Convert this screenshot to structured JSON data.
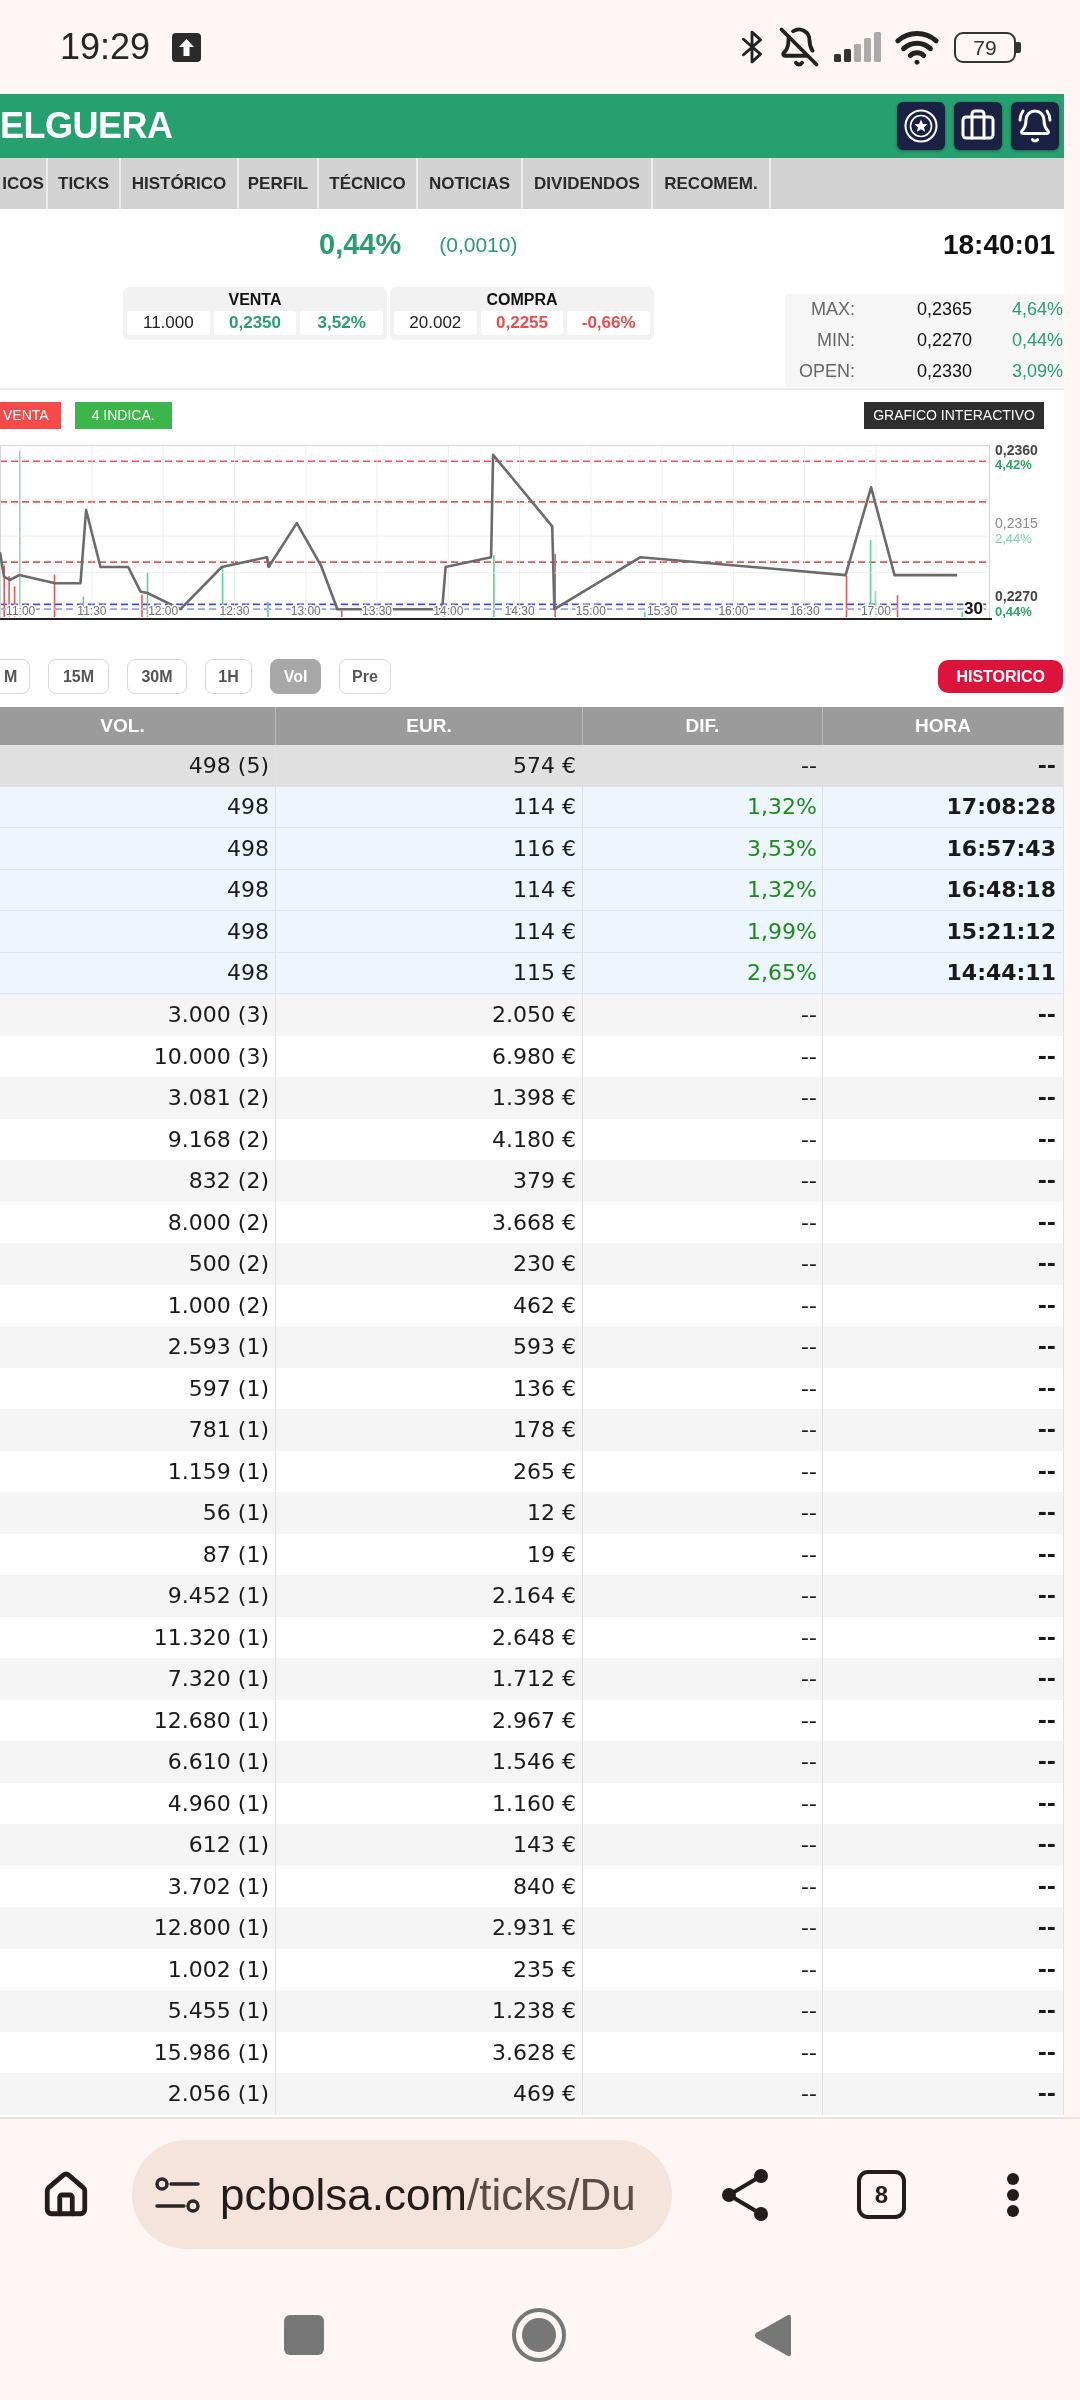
{
  "status_bar": {
    "time": "19:29",
    "battery": "79"
  },
  "header": {
    "title": "ELGUERA"
  },
  "tabs": [
    {
      "label": "ICOS"
    },
    {
      "label": "TICKS"
    },
    {
      "label": "HISTÓRICO"
    },
    {
      "label": "PERFIL"
    },
    {
      "label": "TÉCNICO"
    },
    {
      "label": "NOTICIAS"
    },
    {
      "label": "DIVIDENDOS"
    },
    {
      "label": "RECOMEM."
    }
  ],
  "quote": {
    "change_pct": "0,44%",
    "change_abs": "(0,0010)",
    "time": "18:40:01"
  },
  "order_book": [
    {
      "title": "VENTA",
      "quantity": "11.000",
      "price": "0,2350",
      "change": "3,52%",
      "color": "#2a9d6f"
    },
    {
      "title": "COMPRA",
      "quantity": "20.002",
      "price": "0,2255",
      "change": "-0,66%",
      "color": "#ef4b4b"
    }
  ],
  "range_stats": [
    {
      "label": "MAX:",
      "value": "0,2365",
      "change": "4,64%"
    },
    {
      "label": "MIN:",
      "value": "0,2270",
      "change": "0,44%"
    },
    {
      "label": "OPEN:",
      "value": "0,2330",
      "change": "3,09%"
    }
  ],
  "signals": [
    {
      "label": "VENTA",
      "color": "#f44a4a"
    },
    {
      "label": "4 INDICA.",
      "color": "#3cb54a"
    }
  ],
  "interactive_chart_button": "GRAFICO INTERACTIVO",
  "chart": {
    "period_label": "30",
    "chart_data": {
      "type": "line",
      "x": [
        10.855,
        10.884,
        10.923,
        10.99,
        11.242,
        11.42,
        11.459,
        11.56,
        11.754,
        11.84,
        11.889,
        12.121,
        12.411,
        12.729,
        12.739,
        12.937,
        13.106,
        13.222,
        13.957,
        13.981,
        14.3,
        14.314,
        14.729,
        14.744,
        15.348,
        16.787,
        16.966,
        17.13,
        17.57
      ],
      "values": [
        0.2305,
        0.229,
        0.2288,
        0.2291,
        0.2286,
        0.2286,
        0.2331,
        0.2296,
        0.2296,
        0.2281,
        0.228,
        0.227,
        0.2296,
        0.2302,
        0.2296,
        0.2323,
        0.2297,
        0.227,
        0.227,
        0.2296,
        0.2302,
        0.2365,
        0.2321,
        0.227,
        0.2302,
        0.2291,
        0.2345,
        0.2291,
        0.2291
      ],
      "xlim": [
        10.855,
        17.8
      ],
      "ylim": [
        0.2264,
        0.2371
      ],
      "grid": true,
      "xticks": [
        {
          "value": 11,
          "label": "11:00"
        },
        {
          "value": 11.5,
          "label": "11:30"
        },
        {
          "value": 12,
          "label": "12:00"
        },
        {
          "value": 12.5,
          "label": "12:30"
        },
        {
          "value": 13,
          "label": "13:00"
        },
        {
          "value": 13.5,
          "label": "13:30"
        },
        {
          "value": 14,
          "label": "14:00"
        },
        {
          "value": 14.5,
          "label": "14:30"
        },
        {
          "value": 15,
          "label": "15:00"
        },
        {
          "value": 15.5,
          "label": "15:30"
        },
        {
          "value": 16,
          "label": "16:00"
        },
        {
          "value": 16.5,
          "label": "16:30"
        },
        {
          "value": 17,
          "label": "17:00"
        }
      ],
      "yticks": [
        {
          "value": 0.227,
          "label": "0,2270"
        },
        {
          "value": 0.2315,
          "label": "0,2315"
        },
        {
          "value": 0.236,
          "label": "0,2360"
        }
      ],
      "annotations": [
        "0,44%",
        "2,44%",
        "4,42%"
      ]
    }
  },
  "timeframes": [
    {
      "label": "M",
      "selected": false
    },
    {
      "label": "15M",
      "selected": false
    },
    {
      "label": "30M",
      "selected": false
    },
    {
      "label": "1H",
      "selected": false
    },
    {
      "label": "Vol",
      "selected": true
    },
    {
      "label": "Pre",
      "selected": false
    }
  ],
  "history_button": "HISTORICO",
  "table": {
    "columns": [
      "VOL.",
      "EUR.",
      "DIF.",
      "HORA"
    ],
    "rows": [
      {
        "kind": "total",
        "cells": [
          "498 (5)",
          "574 €",
          "--",
          "--"
        ]
      },
      {
        "kind": "trade",
        "cells": [
          "498",
          "114 €",
          "1,32%",
          "17:08:28"
        ]
      },
      {
        "kind": "trade",
        "cells": [
          "498",
          "116 €",
          "3,53%",
          "16:57:43"
        ]
      },
      {
        "kind": "trade",
        "cells": [
          "498",
          "114 €",
          "1,32%",
          "16:48:18"
        ]
      },
      {
        "kind": "trade",
        "cells": [
          "498",
          "114 €",
          "1,99%",
          "15:21:12"
        ]
      },
      {
        "kind": "trade",
        "cells": [
          "498",
          "115 €",
          "2,65%",
          "14:44:11"
        ]
      },
      {
        "kind": "aggregate",
        "cells": [
          "3.000 (3)",
          "2.050 €",
          "--",
          "--"
        ]
      },
      {
        "kind": "aggregate",
        "cells": [
          "10.000 (3)",
          "6.980 €",
          "--",
          "--"
        ]
      },
      {
        "kind": "aggregate",
        "cells": [
          "3.081 (2)",
          "1.398 €",
          "--",
          "--"
        ]
      },
      {
        "kind": "aggregate",
        "cells": [
          "9.168 (2)",
          "4.180 €",
          "--",
          "--"
        ]
      },
      {
        "kind": "aggregate",
        "cells": [
          "832 (2)",
          "379 €",
          "--",
          "--"
        ]
      },
      {
        "kind": "aggregate",
        "cells": [
          "8.000 (2)",
          "3.668 €",
          "--",
          "--"
        ]
      },
      {
        "kind": "aggregate",
        "cells": [
          "500 (2)",
          "230 €",
          "--",
          "--"
        ]
      },
      {
        "kind": "aggregate",
        "cells": [
          "1.000 (2)",
          "462 €",
          "--",
          "--"
        ]
      },
      {
        "kind": "aggregate",
        "cells": [
          "2.593 (1)",
          "593 €",
          "--",
          "--"
        ]
      },
      {
        "kind": "aggregate",
        "cells": [
          "597 (1)",
          "136 €",
          "--",
          "--"
        ]
      },
      {
        "kind": "aggregate",
        "cells": [
          "781 (1)",
          "178 €",
          "--",
          "--"
        ]
      },
      {
        "kind": "aggregate",
        "cells": [
          "1.159 (1)",
          "265 €",
          "--",
          "--"
        ]
      },
      {
        "kind": "aggregate",
        "cells": [
          "56 (1)",
          "12 €",
          "--",
          "--"
        ]
      },
      {
        "kind": "aggregate",
        "cells": [
          "87 (1)",
          "19 €",
          "--",
          "--"
        ]
      },
      {
        "kind": "aggregate",
        "cells": [
          "9.452 (1)",
          "2.164 €",
          "--",
          "--"
        ]
      },
      {
        "kind": "aggregate",
        "cells": [
          "11.320 (1)",
          "2.648 €",
          "--",
          "--"
        ]
      },
      {
        "kind": "aggregate",
        "cells": [
          "7.320 (1)",
          "1.712 €",
          "--",
          "--"
        ]
      },
      {
        "kind": "aggregate",
        "cells": [
          "12.680 (1)",
          "2.967 €",
          "--",
          "--"
        ]
      },
      {
        "kind": "aggregate",
        "cells": [
          "6.610 (1)",
          "1.546 €",
          "--",
          "--"
        ]
      },
      {
        "kind": "aggregate",
        "cells": [
          "4.960 (1)",
          "1.160 €",
          "--",
          "--"
        ]
      },
      {
        "kind": "aggregate",
        "cells": [
          "612 (1)",
          "143 €",
          "--",
          "--"
        ]
      },
      {
        "kind": "aggregate",
        "cells": [
          "3.702 (1)",
          "840 €",
          "--",
          "--"
        ]
      },
      {
        "kind": "aggregate",
        "cells": [
          "12.800 (1)",
          "2.931 €",
          "--",
          "--"
        ]
      },
      {
        "kind": "aggregate",
        "cells": [
          "1.002 (1)",
          "235 €",
          "--",
          "--"
        ]
      },
      {
        "kind": "aggregate",
        "cells": [
          "5.455 (1)",
          "1.238 €",
          "--",
          "--"
        ]
      },
      {
        "kind": "aggregate",
        "cells": [
          "15.986 (1)",
          "3.628 €",
          "--",
          "--"
        ]
      },
      {
        "kind": "aggregate",
        "cells": [
          "2.056 (1)",
          "469 €",
          "--",
          "--"
        ]
      }
    ]
  },
  "browser": {
    "url_host": "pcbolsa.com",
    "url_path": "/ticks/Du",
    "tab_count": "8"
  }
}
